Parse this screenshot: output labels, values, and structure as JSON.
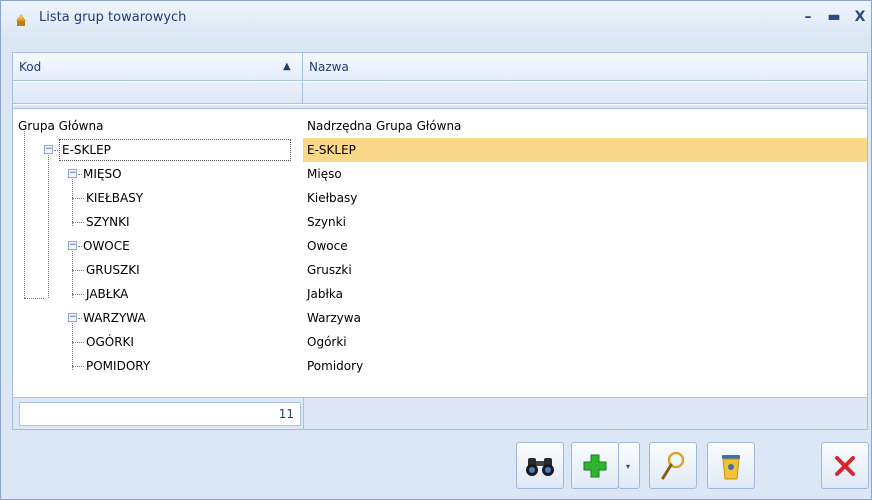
{
  "window": {
    "title": "Lista grup towarowych",
    "min_symbol": "–",
    "max_symbol": "▬",
    "close_symbol": "X"
  },
  "grid": {
    "columns": {
      "kod": "Kod",
      "nazwa": "Nazwa"
    },
    "sort_symbol": "▲",
    "rows": [
      {
        "kod": "Grupa Główna",
        "nazwa": "Nadrzędna Grupa Główna",
        "level": 0,
        "expander": "",
        "selected": false
      },
      {
        "kod": "E-SKLEP",
        "nazwa": "E-SKLEP",
        "level": 1,
        "expander": "−",
        "selected": true
      },
      {
        "kod": "MIĘSO",
        "nazwa": "Mięso",
        "level": 2,
        "expander": "−",
        "selected": false
      },
      {
        "kod": "KIEŁBASY",
        "nazwa": "Kiełbasy",
        "level": 3,
        "expander": "",
        "selected": false
      },
      {
        "kod": "SZYNKI",
        "nazwa": "Szynki",
        "level": 3,
        "expander": "",
        "selected": false
      },
      {
        "kod": "OWOCE",
        "nazwa": "Owoce",
        "level": 2,
        "expander": "−",
        "selected": false
      },
      {
        "kod": "GRUSZKI",
        "nazwa": "Gruszki",
        "level": 3,
        "expander": "",
        "selected": false
      },
      {
        "kod": "JABŁKA",
        "nazwa": "Jabłka",
        "level": 3,
        "expander": "",
        "selected": false
      },
      {
        "kod": "WARZYWA",
        "nazwa": "Warzywa",
        "level": 2,
        "expander": "−",
        "selected": false
      },
      {
        "kod": "OGÓRKI",
        "nazwa": "Ogórki",
        "level": 3,
        "expander": "",
        "selected": false
      },
      {
        "kod": "POMIDORY",
        "nazwa": "Pomidory",
        "level": 3,
        "expander": "",
        "selected": false
      }
    ],
    "footer_count": "11"
  },
  "toolbar": {
    "buttons": [
      "binoculars-icon",
      "plus-icon",
      "magnifier-icon",
      "trash-icon",
      "close-x-icon"
    ],
    "drop_symbol": "▾"
  },
  "colors": {
    "selection": "#f9d888",
    "accent": "#1e3e74",
    "add_green": "#2fb52b",
    "close_red": "#d8262b"
  }
}
